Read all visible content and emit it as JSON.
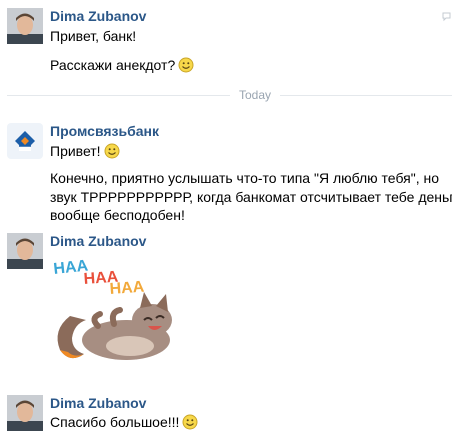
{
  "messages": [
    {
      "author": "Dima Zubanov",
      "lines": [
        "Привет, банк!",
        "Расскажи анекдот?"
      ]
    },
    {
      "author": "Промсвязьбанк",
      "lines": [
        "Привет!",
        "Конечно, приятно услышать что-то типа \"Я люблю тебя\", но",
        "звук ТРРРРРРРРРРР, когда банкомат отсчитывает тебе деньги -",
        "вообще бесподобен!"
      ]
    },
    {
      "author": "Dima Zubanov",
      "sticker_text": [
        "HAA",
        "HAA",
        "HAA"
      ]
    },
    {
      "author": "Dima Zubanov",
      "lines": [
        "Спасибо большое!!!"
      ]
    }
  ],
  "divider": {
    "label": "Today"
  },
  "icons": {
    "emoji": "smiley-emoji-icon",
    "bank_logo": "bank-logo-icon",
    "sticker": "laughing-cat-sticker",
    "corner": "reply-corner-icon"
  },
  "colors": {
    "author": "#2b5788",
    "divider": "#e4e8ec",
    "divider_text": "#9aa5b1",
    "sticker_text": "#3aa6d6",
    "sticker_text_2": "#e9503b",
    "sticker_text_3": "#f2a93b",
    "bank_blue": "#1c5ea8",
    "bank_orange": "#f08a24"
  }
}
